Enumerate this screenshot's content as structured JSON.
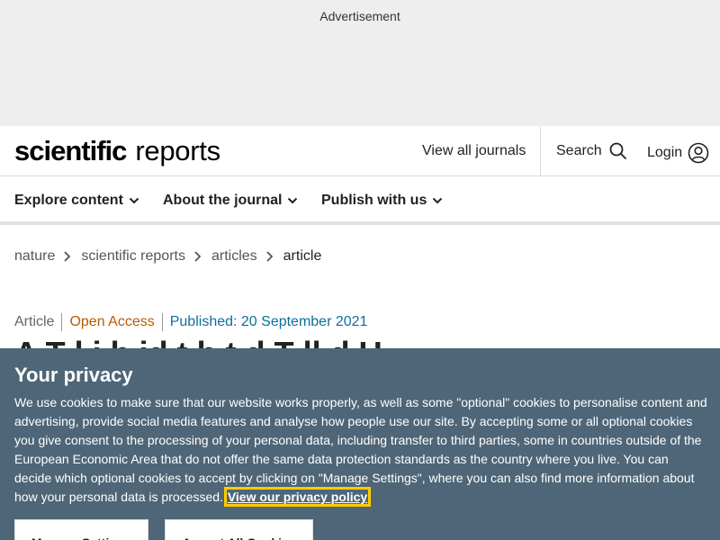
{
  "ad": {
    "label": "Advertisement"
  },
  "header": {
    "logo_bold": "scientific",
    "logo_light": "reports",
    "view_all": "View all journals",
    "search": "Search",
    "login": "Login"
  },
  "nav": {
    "items": [
      {
        "label": "Explore content"
      },
      {
        "label": "About the journal"
      },
      {
        "label": "Publish with us"
      }
    ]
  },
  "breadcrumb": {
    "items": [
      {
        "label": "nature"
      },
      {
        "label": "scientific reports"
      },
      {
        "label": "articles"
      },
      {
        "label": "article"
      }
    ]
  },
  "article": {
    "type": "Article",
    "access": "Open Access",
    "published": "Published: 20 September 2021",
    "title_peek": "A T                    l  i    b  id    t b  t      d T ll  d U"
  },
  "cookie": {
    "heading": "Your privacy",
    "body": "We use cookies to make sure that our website works properly, as well as some \"optional\" cookies to personalise content and advertising, provide social media features and analyse how people use our site. By accepting some or all optional cookies you give consent to the processing of your personal data, including transfer to third parties, some in countries outside of the European Economic Area that do not offer the same data protection standards as the country where you live. You can decide which optional cookies to accept by clicking on \"Manage Settings\", where you can also find more information about how your personal data is processed.",
    "policy_link": "View our privacy policy",
    "manage_button": "Manage Settings",
    "accept_button": "Accept All Cookies"
  },
  "colors": {
    "cookie_bg": "#4e6677",
    "open_access": "#b95b00",
    "published": "#0c6f9e",
    "focus_outline": "#ffcc00"
  }
}
